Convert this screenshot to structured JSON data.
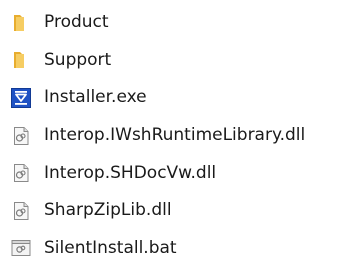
{
  "files": [
    {
      "name": "Product",
      "icon": "folder-icon",
      "type": "folder"
    },
    {
      "name": "Support",
      "icon": "folder-icon",
      "type": "folder"
    },
    {
      "name": "Installer.exe",
      "icon": "installer-icon",
      "type": "exe"
    },
    {
      "name": "Interop.IWshRuntimeLibrary.dll",
      "icon": "dll-file-icon",
      "type": "dll"
    },
    {
      "name": "Interop.SHDocVw.dll",
      "icon": "dll-file-icon",
      "type": "dll"
    },
    {
      "name": "SharpZipLib.dll",
      "icon": "dll-file-icon",
      "type": "dll"
    },
    {
      "name": "SilentInstall.bat",
      "icon": "batch-file-icon",
      "type": "bat"
    }
  ],
  "colors": {
    "folder": "#f2c45a",
    "installer": "#1c4fbf",
    "file_outline": "#8a8a8a"
  }
}
